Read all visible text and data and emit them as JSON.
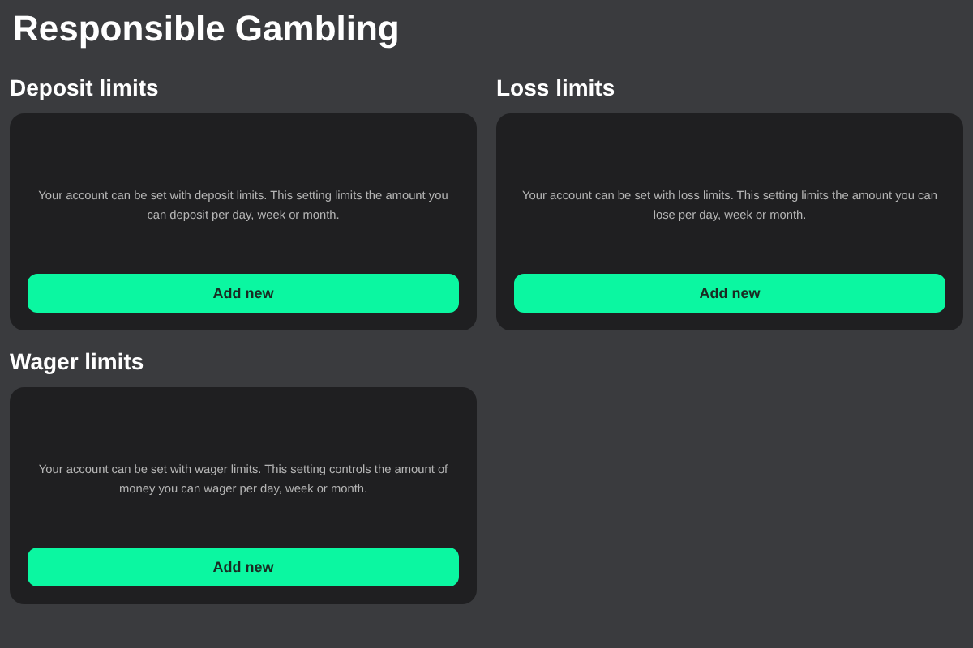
{
  "title": "Responsible Gambling",
  "sections": [
    {
      "heading": "Deposit limits",
      "description": "Your account can be set with deposit limits. This setting limits the amount you can deposit per day, week or month.",
      "button": "Add new"
    },
    {
      "heading": "Loss limits",
      "description": "Your account can be set with loss limits. This setting limits the amount you can lose per day, week or month.",
      "button": "Add new"
    },
    {
      "heading": "Wager limits",
      "description": "Your account can be set with wager limits. This setting controls the amount of money you can wager per day, week or month.",
      "button": "Add new"
    }
  ]
}
